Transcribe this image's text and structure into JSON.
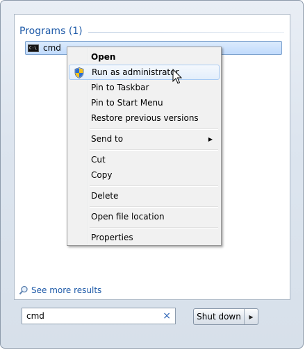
{
  "search_panel": {
    "section_title": "Programs (1)",
    "result_label": "cmd",
    "result_icon": "cmd-icon",
    "see_more_label": "See more results",
    "search_value": "cmd",
    "clear_glyph": "×",
    "shutdown_label": "Shut down"
  },
  "context_menu": {
    "items": [
      {
        "label": "Open",
        "bold": true
      },
      {
        "label": "Run as administrator",
        "icon": "shield-icon",
        "highlighted": true
      },
      {
        "label": "Pin to Taskbar"
      },
      {
        "label": "Pin to Start Menu"
      },
      {
        "label": "Restore previous versions"
      },
      {
        "label": "Send to",
        "submenu": true
      },
      {
        "label": "Cut"
      },
      {
        "label": "Copy"
      },
      {
        "label": "Delete"
      },
      {
        "label": "Open file location"
      },
      {
        "label": "Properties"
      }
    ]
  },
  "colors": {
    "link_blue": "#1e5aa8",
    "selection_fill": "#c1dbfc",
    "menu_background": "#f1f1f1"
  }
}
